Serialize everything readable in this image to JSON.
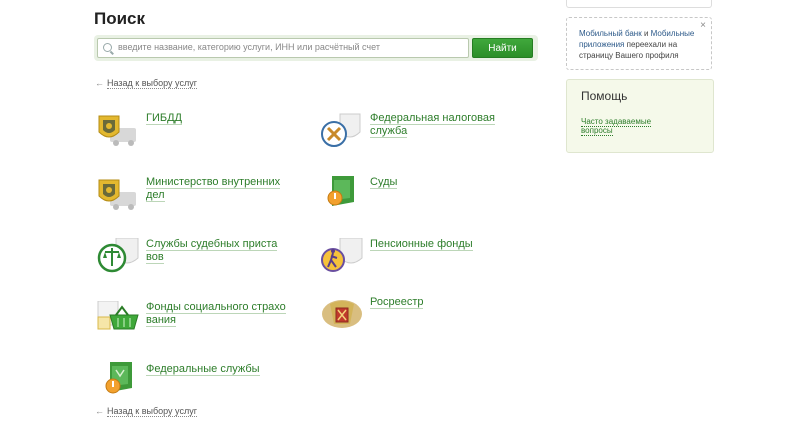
{
  "page": {
    "title": "Поиск"
  },
  "search": {
    "placeholder": "введите название, категорию услуги, ИНН или расчётный счет",
    "button_label": "Найти"
  },
  "back_link": {
    "arrow": "←",
    "label": "Назад к выбору услуг"
  },
  "services": [
    {
      "name": "ГИБДД",
      "icon": "gibdd-emblem-icon"
    },
    {
      "name": "Федеральная налоговая служба",
      "icon": "tax-service-icon"
    },
    {
      "name": "Министерство внутренних дел",
      "icon": "mvd-emblem-icon"
    },
    {
      "name": "Суды",
      "icon": "courts-icon"
    },
    {
      "name": "Службы судебных приста вов",
      "icon": "bailiffs-scales-icon"
    },
    {
      "name": "Пенсионные фонды",
      "icon": "pension-fund-icon"
    },
    {
      "name": "Фонды социального страхо вания",
      "icon": "social-insurance-basket-icon"
    },
    {
      "name": "Росреестр",
      "icon": "rosreestr-eagle-icon"
    },
    {
      "name": "Федеральные службы",
      "icon": "federal-services-icon"
    }
  ],
  "side_note": {
    "link1": "Мобильный банк",
    "conj": " и ",
    "link2": "Мобильные приложения",
    "rest": " переехали на страницу Вашего профиля",
    "close": "×"
  },
  "help": {
    "title": "Помощь",
    "faq_link": "Часто задаваемые вопросы"
  },
  "colors": {
    "accent_green": "#2d7d2a",
    "button_green": "#34a030",
    "help_bg": "#f5f9ea"
  }
}
